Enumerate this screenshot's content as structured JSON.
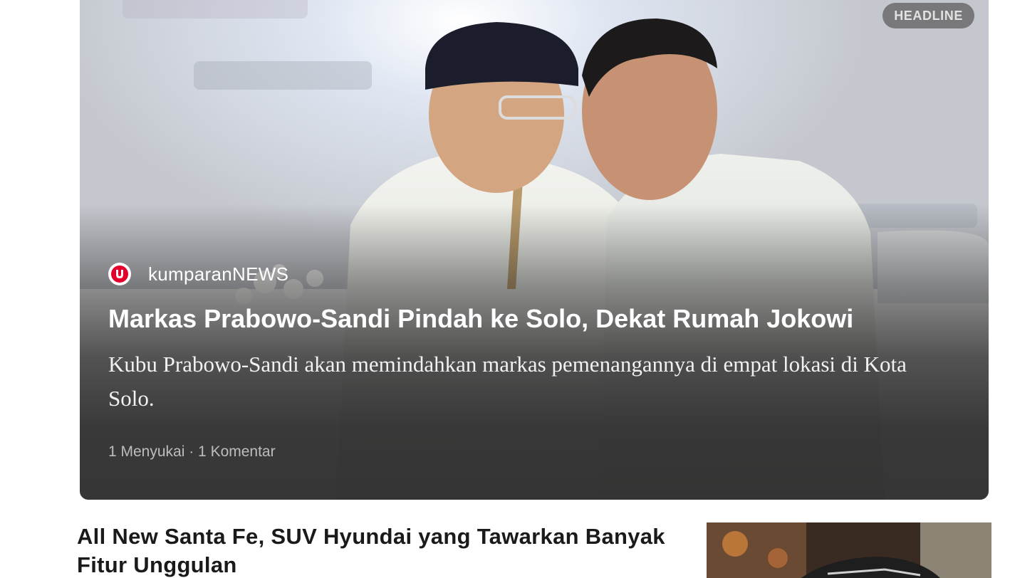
{
  "headline_card": {
    "badge": "HEADLINE",
    "source_name": "kumparanNEWS",
    "source_logo_icon": "kumparan-logo-icon",
    "title": "Markas Prabowo-Sandi Pindah ke Solo, Dekat Rumah Jokowi",
    "summary": "Kubu Prabowo-Sandi akan memindahkan markas pemenangannya di empat lokasi di Kota Solo.",
    "stats": "1 Menyukai · 1 Komentar",
    "likes": 1,
    "comments": 1
  },
  "articles": [
    {
      "title": "All New Santa Fe, SUV Hyundai yang Tawarkan Banyak Fitur Unggulan"
    }
  ],
  "colors": {
    "brand": "#e4002b",
    "badge_bg": "#5a5a5a",
    "title_text": "#1a1a1a"
  }
}
